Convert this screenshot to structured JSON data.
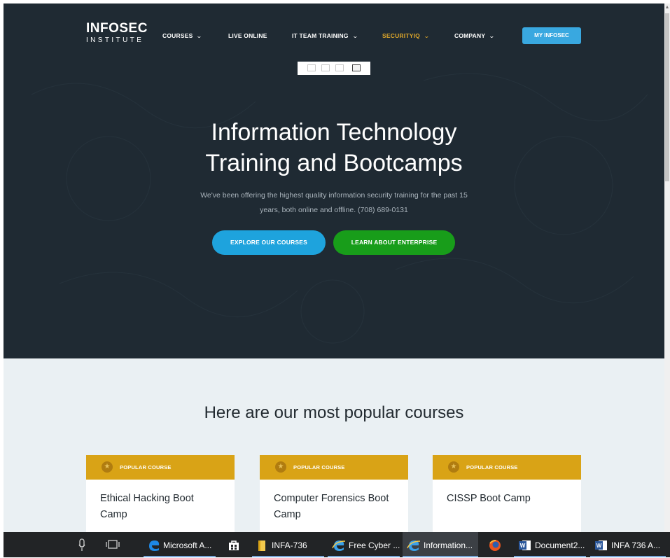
{
  "nav": {
    "logo_top": "INFOSEC",
    "logo_bottom": "INSTITUTE",
    "items": [
      {
        "label": "COURSES",
        "dropdown": true
      },
      {
        "label": "LIVE ONLINE",
        "dropdown": false
      },
      {
        "label": "IT TEAM TRAINING",
        "dropdown": true
      },
      {
        "label": "SECURITYIQ",
        "dropdown": true
      },
      {
        "label": "COMPANY",
        "dropdown": true
      }
    ],
    "cta_label": "MY INFOSEC"
  },
  "hero": {
    "title_line1": "Information Technology",
    "title_line2": "Training and Bootcamps",
    "subtitle_line1": "We've been offering the highest quality information security training for the past 15",
    "subtitle_line2": "years, both online and offline. (708) 689-0131",
    "primary_button": "EXPLORE OUR COURSES",
    "secondary_button": "LEARN ABOUT ENTERPRISE"
  },
  "popular": {
    "heading": "Here are our most popular courses",
    "cards": [
      {
        "tag": "POPULAR COURSE",
        "title": "Ethical Hacking Boot Camp"
      },
      {
        "tag": "POPULAR COURSE",
        "title": "Computer Forensics Boot Camp"
      },
      {
        "tag": "POPULAR COURSE",
        "title": "CISSP Boot Camp"
      }
    ]
  },
  "taskbar": {
    "items": [
      {
        "label": "Microsoft A...",
        "icon": "edge-icon"
      },
      {
        "label": "",
        "icon": "store-icon"
      },
      {
        "label": "INFA-736",
        "icon": "folder-icon"
      },
      {
        "label": "Free Cyber ...",
        "icon": "ie-icon"
      },
      {
        "label": "Information...",
        "icon": "ie-icon"
      },
      {
        "label": "",
        "icon": "firefox-icon"
      },
      {
        "label": "Document2...",
        "icon": "word-icon"
      },
      {
        "label": "INFA 736 A...",
        "icon": "word-icon"
      }
    ]
  },
  "colors": {
    "hero_bg": "#1f2a33",
    "accent_blue": "#1ea3dd",
    "accent_green": "#189d1a",
    "accent_gold": "#d9a316",
    "securityiq": "#e0a82a"
  }
}
